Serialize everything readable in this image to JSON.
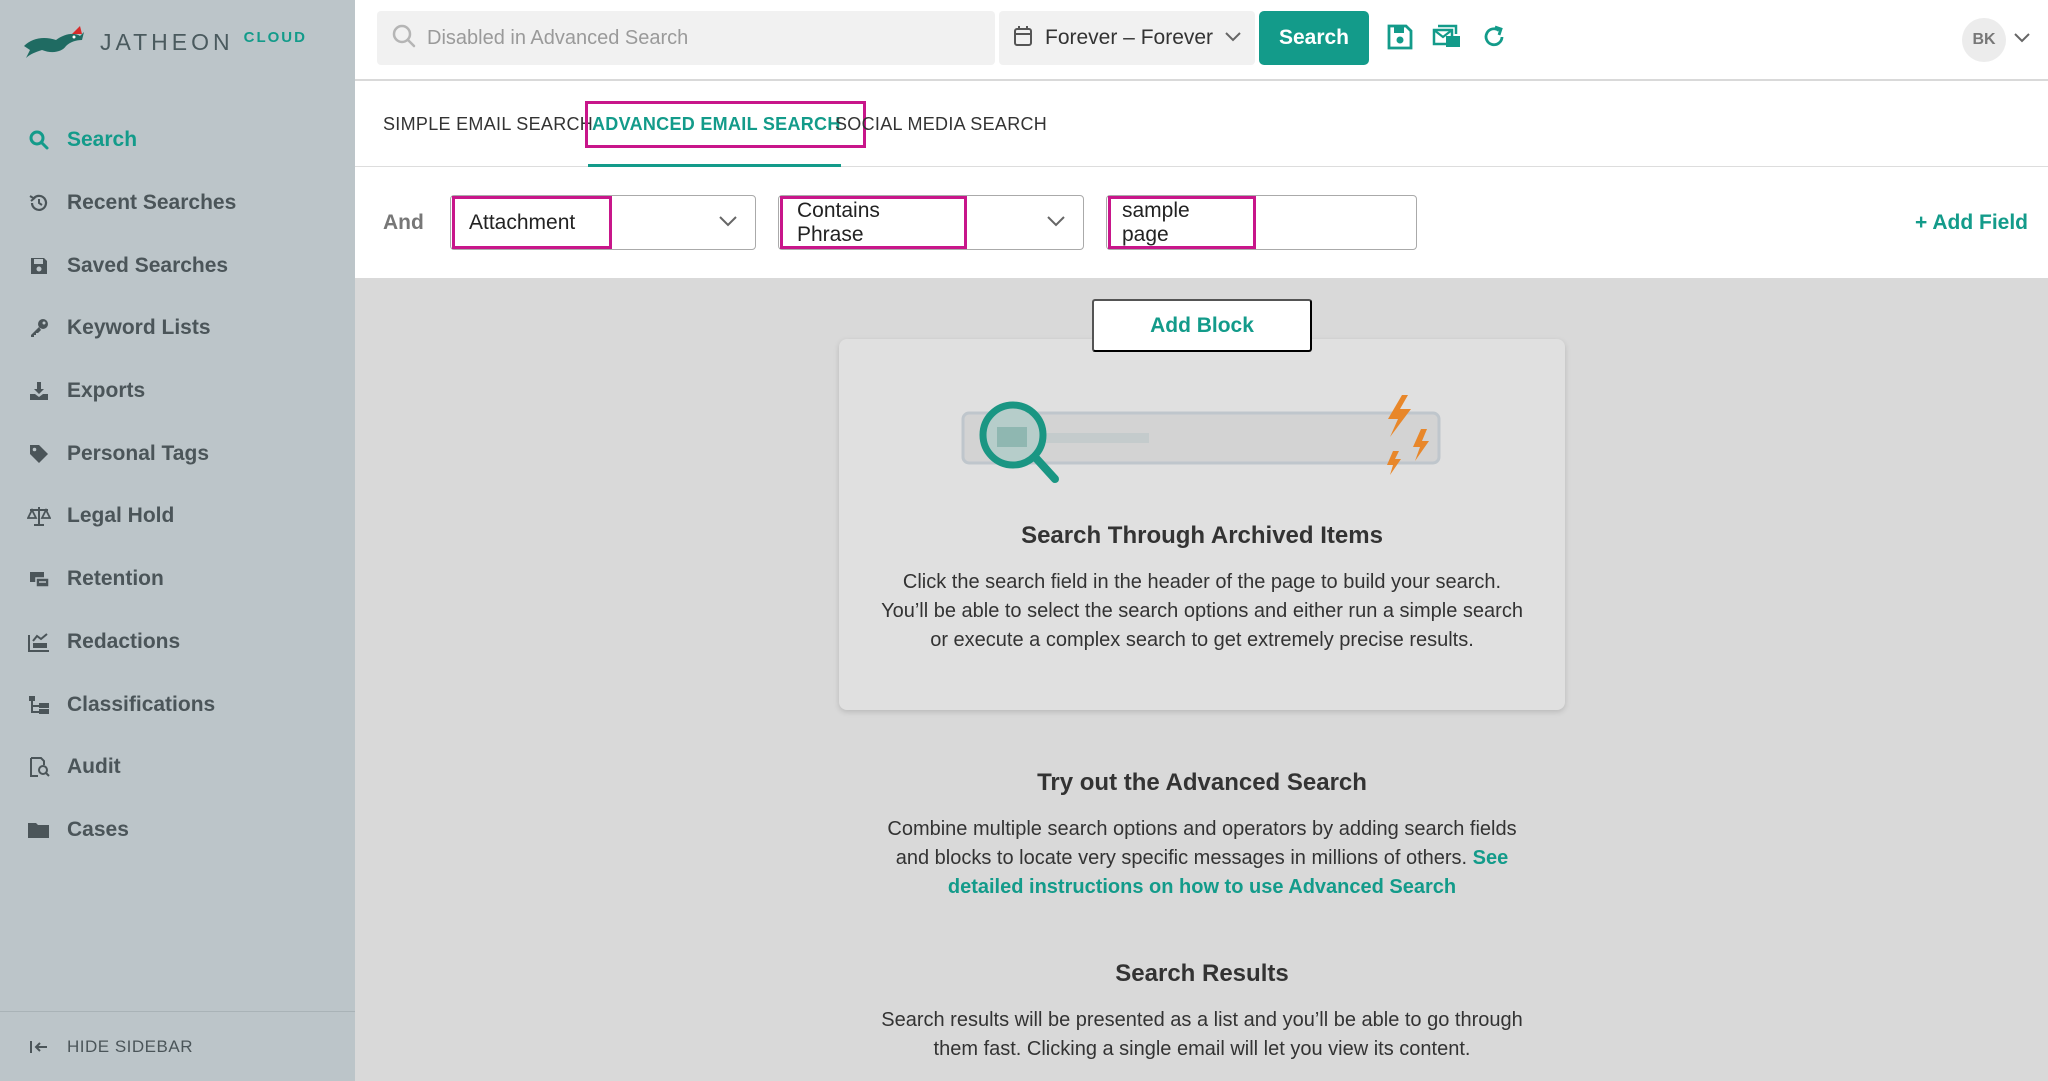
{
  "app": {
    "logo_word": "JATHEON",
    "logo_suffix": "CLOUD"
  },
  "sidebar": {
    "items": [
      {
        "label": "Search",
        "icon": "search-icon",
        "active": true
      },
      {
        "label": "Recent Searches",
        "icon": "history-icon"
      },
      {
        "label": "Saved Searches",
        "icon": "floppy-disk-icon"
      },
      {
        "label": "Keyword Lists",
        "icon": "key-icon"
      },
      {
        "label": "Exports",
        "icon": "download-icon"
      },
      {
        "label": "Personal Tags",
        "icon": "tag-icon"
      },
      {
        "label": "Legal Hold",
        "icon": "scales-icon"
      },
      {
        "label": "Retention",
        "icon": "archive-box-icon"
      },
      {
        "label": "Redactions",
        "icon": "redaction-icon"
      },
      {
        "label": "Classifications",
        "icon": "hierarchy-icon"
      },
      {
        "label": "Audit",
        "icon": "audit-icon"
      },
      {
        "label": "Cases",
        "icon": "folder-icon"
      }
    ],
    "hide_label": "HIDE SIDEBAR"
  },
  "header": {
    "search_placeholder": "Disabled in Advanced Search",
    "date_range": "Forever – Forever",
    "search_button": "Search",
    "avatar_initials": "BK"
  },
  "tabs": [
    {
      "label": "SIMPLE EMAIL SEARCH"
    },
    {
      "label": "ADVANCED EMAIL SEARCH",
      "active": true
    },
    {
      "label": "SOCIAL MEDIA SEARCH"
    }
  ],
  "query": {
    "operator": "And",
    "field": "Attachment",
    "condition": "Contains Phrase",
    "value": "sample page",
    "add_field": "+ Add Field"
  },
  "main": {
    "add_block": "Add Block",
    "card_title": "Search Through Archived Items",
    "card_body": "Click the search field in the header of the page to build your search. You’ll be able to select the search options and either run a simple search or execute a complex search to get extremely precise results.",
    "advanced_title": "Try out the Advanced Search",
    "advanced_body": "Combine multiple search options and operators by adding search fields and blocks to locate very specific messages in millions of others.",
    "advanced_link": "See detailed instructions on how to use Advanced Search",
    "results_title": "Search Results",
    "results_body": "Search results will be presented as a list and you’ll be able to go through them fast. Clicking a single email will let you view its content."
  },
  "colors": {
    "accent": "#139b8a",
    "highlight": "#c8168a",
    "sidebar_bg": "#bcc5c9",
    "illustration_orange": "#e8872a"
  }
}
